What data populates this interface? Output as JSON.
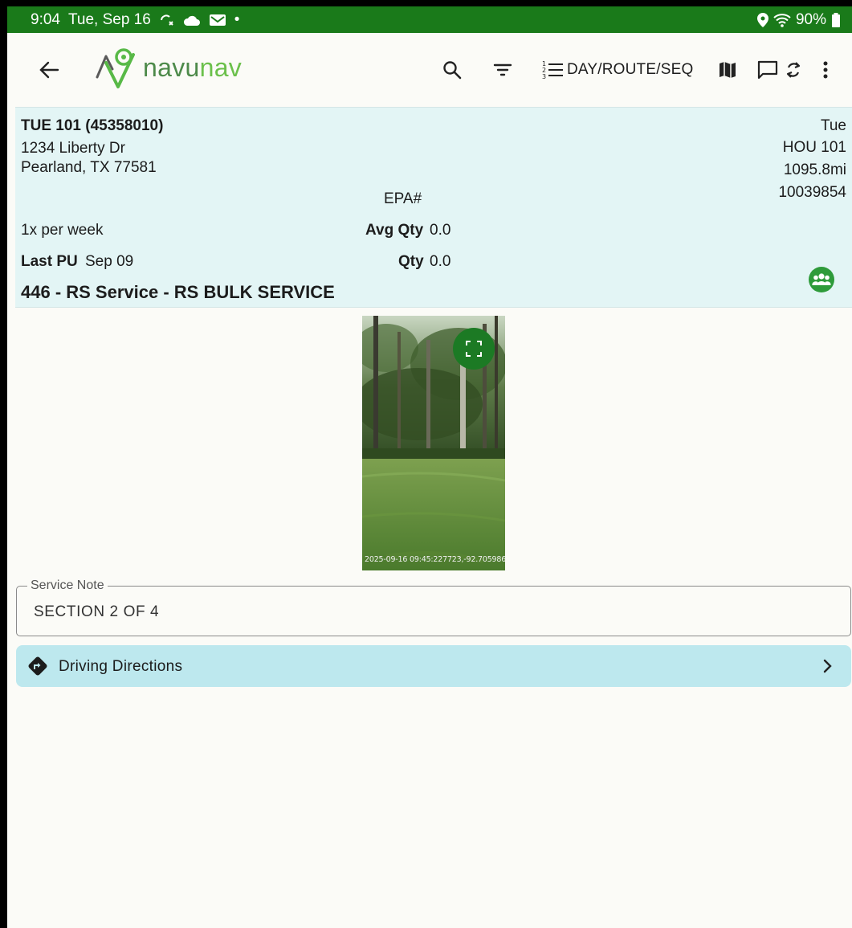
{
  "status_bar": {
    "time": "9:04",
    "date": "Tue, Sep 16",
    "dot": "•",
    "battery": "90%"
  },
  "app_bar": {
    "logo_text_a": "navu",
    "logo_text_b": "nav",
    "sort_label": "DAY/ROUTE/SEQ"
  },
  "stop": {
    "title": "TUE 101 (45358010)",
    "address_line1": "1234 Liberty Dr",
    "address_line2": "Pearland, TX 77581",
    "epa_label": "EPA#",
    "frequency": "1x per week",
    "avg_qty_label": "Avg Qty",
    "avg_qty_value": "0.0",
    "last_pu_label": "Last PU",
    "last_pu_value": "Sep 09",
    "qty_label": "Qty",
    "qty_value": "0.0",
    "service": "446 - RS Service - RS BULK SERVICE",
    "day": "Tue",
    "route": "HOU 101",
    "distance": "1095.8mi",
    "account_no": "10039854"
  },
  "photo": {
    "stamp": "2025-09-16 09:45:227723,-92.705986"
  },
  "service_note": {
    "label": "Service Note",
    "value": "SECTION 2 OF 4"
  },
  "directions": {
    "label": "Driving Directions"
  },
  "colors": {
    "status_bar": "#1a7a1a",
    "card_bg": "#e3f5f5",
    "directions_bg": "#bde8ee",
    "accent_green": "#1c7a24"
  }
}
